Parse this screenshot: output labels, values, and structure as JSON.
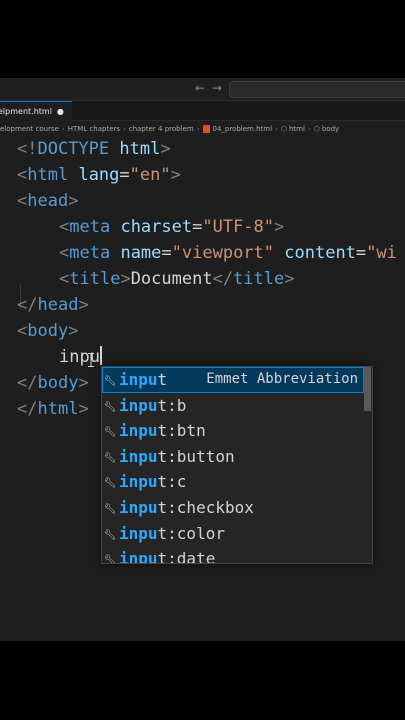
{
  "tab": {
    "label": "elpment.html",
    "dot": "●"
  },
  "breadcrumb": {
    "items": [
      "elopment course",
      "HTML chapters",
      "chapter 4 problem",
      "04_problem.html",
      "html",
      "body"
    ],
    "separator": "›"
  },
  "nav": {
    "back": "←",
    "forward": "→"
  },
  "code": {
    "doctype": {
      "open": "<!",
      "keyword": "DOCTYPE",
      "value": " html",
      "close": ">"
    },
    "html_open": {
      "tag": "html",
      "attr": "lang",
      "val": "\"en\""
    },
    "head_open": "head",
    "meta1": {
      "tag": "meta",
      "attr": "charset",
      "val": "\"UTF-8\""
    },
    "meta2": {
      "tag": "meta",
      "attr1": "name",
      "val1": "\"viewport\"",
      "attr2": "content",
      "val2": "\"wi"
    },
    "title": {
      "tag": "title",
      "text": "Document"
    },
    "head_close": "head",
    "body_open": "body",
    "typed": "inpu",
    "body_close": "body",
    "html_close": "html"
  },
  "suggest": {
    "typed_match": "inpu",
    "selected_detail": "Emmet Abbreviation",
    "items": [
      {
        "match": "inpu",
        "rest": "t"
      },
      {
        "match": "inpu",
        "rest": "t:b"
      },
      {
        "match": "inpu",
        "rest": "t:btn"
      },
      {
        "match": "inpu",
        "rest": "t:button"
      },
      {
        "match": "inpu",
        "rest": "t:c"
      },
      {
        "match": "inpu",
        "rest": "t:checkbox"
      },
      {
        "match": "inpu",
        "rest": "t:color"
      },
      {
        "match": "inpu",
        "rest": "t:date"
      }
    ]
  },
  "colors": {
    "editor_bg": "#1e1e1e",
    "tag": "#569cd6",
    "attr": "#9cdcfe",
    "string": "#ce9178",
    "bracket": "#808080",
    "suggest_match": "#2aaaff",
    "selected_row": "#04395e"
  }
}
